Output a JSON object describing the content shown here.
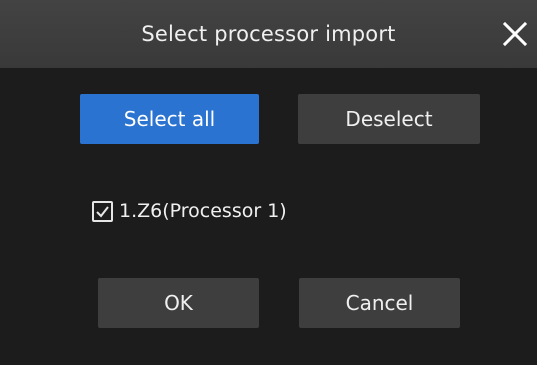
{
  "dialog": {
    "title": "Select processor import",
    "close_icon": "close-icon"
  },
  "actions": {
    "select_all_label": "Select all",
    "deselect_label": "Deselect"
  },
  "processors": [
    {
      "label": "1.Z6(Processor 1)",
      "checked": true
    }
  ],
  "footer": {
    "ok_label": "OK",
    "cancel_label": "Cancel"
  },
  "colors": {
    "titlebar": "#3d3d3d",
    "body": "#1c1c1c",
    "primary_button": "#2b73d0",
    "secondary_button": "#3e3e3e",
    "text": "#f0f0f0"
  }
}
